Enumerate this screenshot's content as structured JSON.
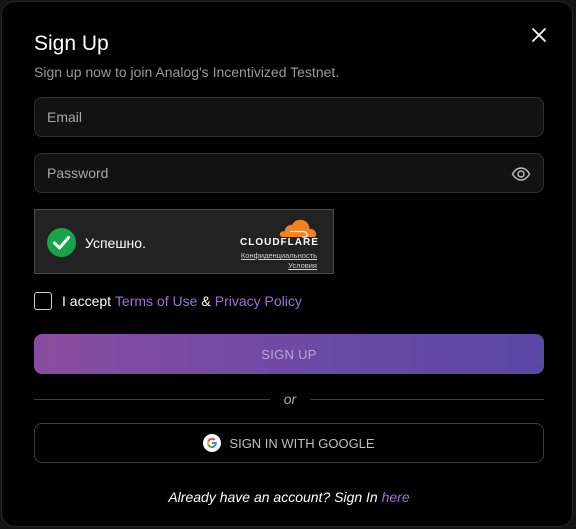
{
  "modal": {
    "title": "Sign Up",
    "subtitle": "Sign up now to join Analog's Incentivized Testnet.",
    "close_icon": "close-icon"
  },
  "form": {
    "email": {
      "value": "",
      "placeholder": "Email"
    },
    "password": {
      "value": "",
      "placeholder": "Password",
      "toggle_icon": "eye-icon"
    }
  },
  "captcha": {
    "status_text": "Успешно.",
    "status_icon": "checkmark-icon",
    "brand": "CLOUDFLARE",
    "privacy_link": "Конфиденциальность",
    "terms_link": "Условия"
  },
  "terms": {
    "prefix": "I accept",
    "terms_link": "Terms of Use",
    "ampersand": "&",
    "privacy_link": "Privacy Policy"
  },
  "buttons": {
    "signup": "SIGN UP",
    "google": "SIGN IN WITH GOOGLE",
    "google_icon": "google-icon"
  },
  "divider": {
    "text": "or"
  },
  "footer": {
    "text": "Already have an account? Sign In",
    "link": "here"
  },
  "colors": {
    "accent": "#9b72d6",
    "button_gradient_start": "#8a4c9f",
    "button_gradient_end": "#5a47a3",
    "success_green": "#19a34a",
    "cloudflare_orange": "#f48120",
    "background": "#000000"
  }
}
